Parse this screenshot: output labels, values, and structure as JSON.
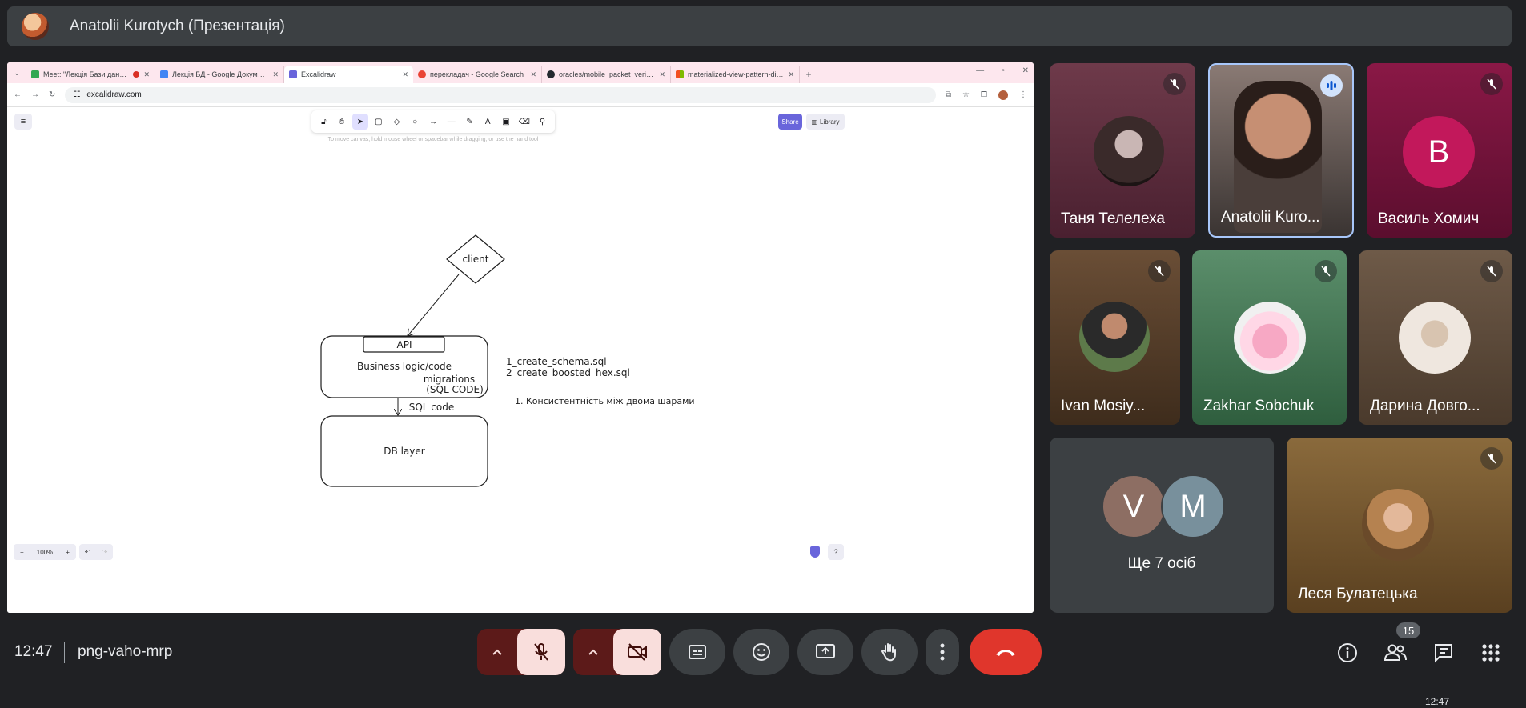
{
  "presenter": {
    "name": "Anatolii Kurotych (Презентація)"
  },
  "browser": {
    "tabs": [
      {
        "label": "Meet: \"Лекція Бази даних\"",
        "icon": "meet-icon",
        "color": "#34a853",
        "recording": true
      },
      {
        "label": "Лекція БД - Google Документи",
        "icon": "docs-icon",
        "color": "#4285f4"
      },
      {
        "label": "Excalidraw",
        "icon": "excalidraw-icon",
        "color": "#6965db",
        "active": true
      },
      {
        "label": "перекладач - Google Search",
        "icon": "google-icon",
        "color": "#ea4335"
      },
      {
        "label": "oracles/mobile_packet_verifier",
        "icon": "github-icon",
        "color": "#24292f"
      },
      {
        "label": "materialized-view-pattern-diag",
        "icon": "microsoft-icon",
        "color": "#f25022"
      }
    ],
    "url": "excalidraw.com"
  },
  "excalidraw": {
    "hint": "To move canvas, hold mouse wheel or spacebar while dragging, or use the hand tool",
    "share_label": "Share",
    "library_label": "Library",
    "zoom": "100%",
    "shapes": {
      "client": "client",
      "api": "API",
      "business": "Business logic/code",
      "migrations": "migrations",
      "sql_code_paren": "(SQL CODE)",
      "sql_code": "SQL code",
      "db_layer": "DB layer",
      "file1": "1_create_schema.sql",
      "file2": "2_create_boosted_hex.sql",
      "note": "1. Консистентність між двома шарами"
    }
  },
  "participants": [
    {
      "name": "Таня Телелеха",
      "muted": true
    },
    {
      "name": "Anatolii Kuro...",
      "speaking": true
    },
    {
      "name": "Василь Хомич",
      "muted": true,
      "initial": "B"
    },
    {
      "name": "Ivan Mosiy...",
      "muted": true
    },
    {
      "name": "Zakhar Sobchuk",
      "muted": true
    },
    {
      "name": "Дарина Довго...",
      "muted": true
    },
    {
      "name": "Ще 7 осіб",
      "initials": [
        "V",
        "M"
      ]
    },
    {
      "name": "Леся Булатецька",
      "muted": true
    }
  ],
  "bottom_bar": {
    "time": "12:47",
    "meeting_code": "png-vaho-mrp",
    "participant_count": "15"
  },
  "taskbar": {
    "time": "12:47"
  },
  "colors": {
    "end_call": "#e0362c",
    "excalidraw_accent": "#6965db",
    "mic_off_bg": "#f9dedc"
  }
}
